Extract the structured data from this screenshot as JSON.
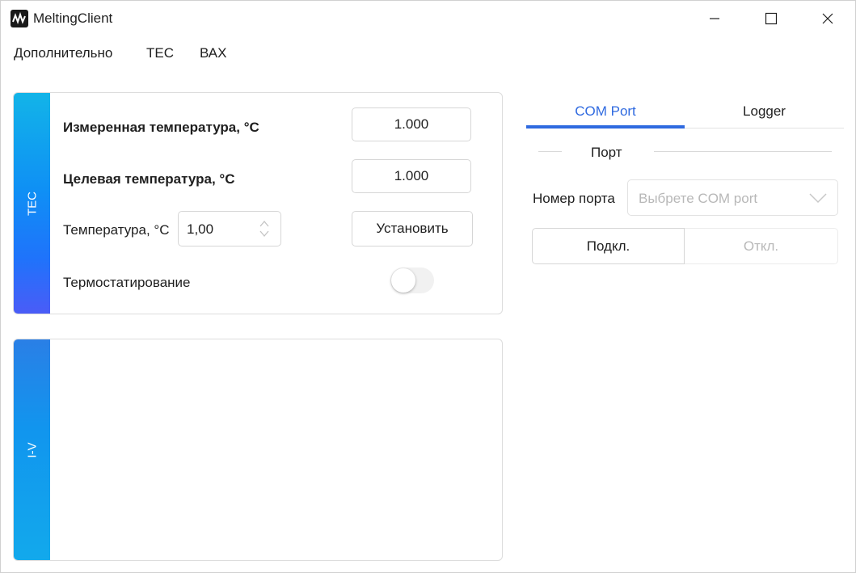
{
  "window": {
    "title": "MeltingClient",
    "icon": "app-logo-icon",
    "controls": [
      "minimize-icon",
      "maximize-icon",
      "close-icon"
    ]
  },
  "menu": {
    "items": [
      {
        "label": "Дополнительно"
      },
      {
        "label": "TEC"
      },
      {
        "label": "ВАХ"
      }
    ]
  },
  "tec_card": {
    "strip_label": "TEC",
    "measured_label": "Измеренная температура, °C",
    "measured_value": "1.000",
    "target_label": "Целевая температура, °C",
    "target_value": "1.000",
    "temperature_label": "Температура, °C",
    "temperature_value": "1,00",
    "set_button": "Установить",
    "thermostat_label": "Термостатирование",
    "thermostat_on": false
  },
  "iv_card": {
    "strip_label": "I-V"
  },
  "right_panel": {
    "tabs": [
      {
        "label": "COM Port",
        "active": true
      },
      {
        "label": "Logger",
        "active": false
      }
    ],
    "section_title": "Порт",
    "port_label": "Номер порта",
    "port_placeholder": "Выбрете COM port",
    "connect_button": "Подкл.",
    "disconnect_button": "Откл."
  },
  "colors": {
    "accent": "#2f6ae0",
    "strip_tec_top": "#12b4e8",
    "strip_tec_bottom": "#4a5cf7",
    "strip_iv": "#1195ee",
    "disabled_text": "#b8b8b8"
  }
}
